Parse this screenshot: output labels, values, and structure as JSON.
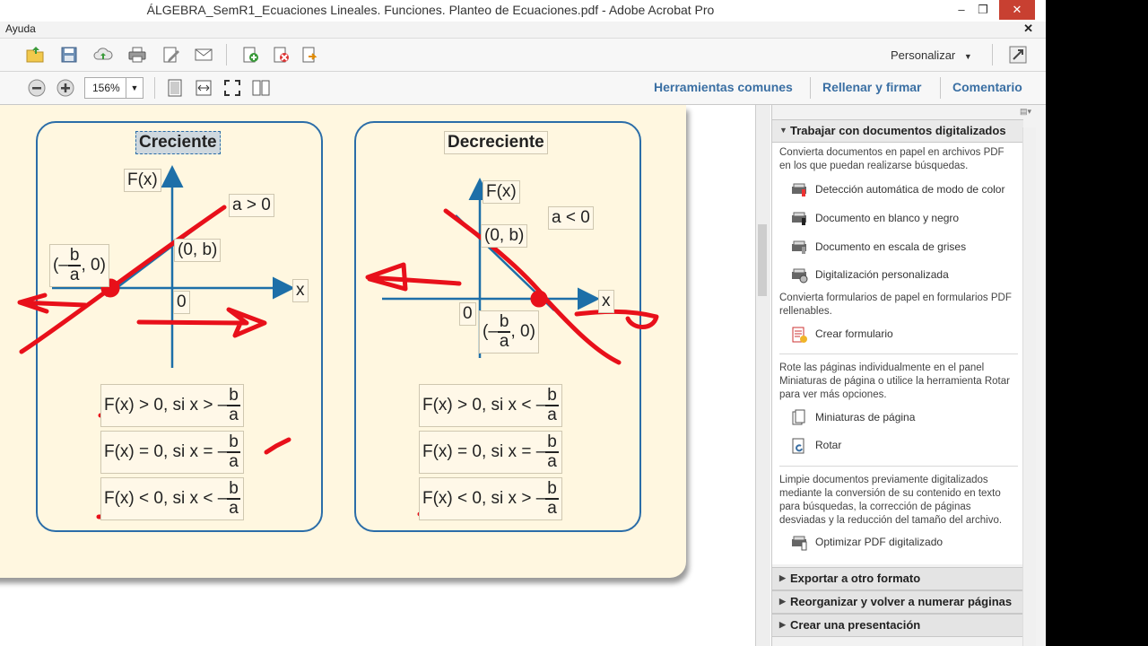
{
  "window": {
    "title": "ÁLGEBRA_SemR1_Ecuaciones Lineales. Funciones. Planteo de Ecuaciones.pdf - Adobe Acrobat Pro",
    "minimize": "–",
    "restore": "❐",
    "close": "✕"
  },
  "menubar": {
    "help": "Ayuda",
    "close_doc": "✕"
  },
  "toolbar": {
    "customize": "Personalizar",
    "zoom": "156%",
    "links": [
      "Herramientas comunes",
      "Rellenar y firmar",
      "Comentario"
    ]
  },
  "page": {
    "left_title": "Creciente",
    "right_title": "Decreciente",
    "left": {
      "fx": "F(x)",
      "cond": "a > 0",
      "point_b": "(0, b)",
      "root_pre": "(–",
      "root_post": ", 0)",
      "x": "x",
      "zero": "0",
      "rules": [
        {
          "pre": "F(x) > 0, si x > –",
          "num": "b",
          "den": "a"
        },
        {
          "pre": "F(x) = 0, si x = –",
          "num": "b",
          "den": "a"
        },
        {
          "pre": "F(x) < 0, si x < –",
          "num": "b",
          "den": "a"
        }
      ]
    },
    "right": {
      "fx": "F(x)",
      "cond": "a < 0",
      "point_b": "(0, b)",
      "root_pre": "(–",
      "root_post": ", 0)",
      "x": "x",
      "zero": "0",
      "rules": [
        {
          "pre": "F(x) > 0, si x < –",
          "num": "b",
          "den": "a"
        },
        {
          "pre": "F(x) = 0, si x = –",
          "num": "b",
          "den": "a"
        },
        {
          "pre": "F(x) < 0, si x > –",
          "num": "b",
          "den": "a"
        }
      ]
    }
  },
  "panel": {
    "section_title": "Trabajar con documentos digitalizados",
    "intro1": "Convierta documentos en papel en archivos PDF en los que puedan realizarse búsquedas.",
    "items1": [
      {
        "label": "Detección automática de modo de color",
        "icon": "scanner-color-icon"
      },
      {
        "label": "Documento en blanco y negro",
        "icon": "scanner-bw-icon"
      },
      {
        "label": "Documento en escala de grises",
        "icon": "scanner-gray-icon"
      },
      {
        "label": "Digitalización personalizada",
        "icon": "scanner-custom-icon"
      }
    ],
    "intro2": "Convierta formularios de papel en formularios PDF rellenables.",
    "item_form": "Crear formulario",
    "intro3": "Rote las páginas individualmente en el panel Miniaturas de página o utilice la herramienta Rotar para ver más opciones.",
    "item_thumbs": "Miniaturas de página",
    "item_rotate": "Rotar",
    "intro4": "Limpie documentos previamente digitalizados mediante la conversión de su contenido en texto para búsquedas, la corrección de páginas desviadas y la reducción del tamaño del archivo.",
    "item_optimize": "Optimizar PDF digitalizado",
    "collapsed": [
      "Exportar a otro formato",
      "Reorganizar y volver a numerar páginas",
      "Crear una presentación"
    ]
  },
  "colors": {
    "accent_link": "#3a6fa3",
    "box_border": "#2b6da8",
    "ink": "#e8101a",
    "page_bg": "#fff7e0"
  }
}
